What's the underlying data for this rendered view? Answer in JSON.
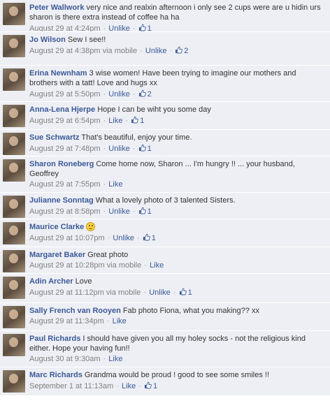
{
  "comments": [
    {
      "author": "Peter Wallwork",
      "text": "very nice and realxin afternoon i only see 2 cups were are u hidin urs sharon is there extra instead of coffee ha ha",
      "time": "August 29 at 4:24pm",
      "via": "",
      "action": "Unlike",
      "likes": "1",
      "smiley": false,
      "height": 46
    },
    {
      "author": "Jo Wilson",
      "text": "Sew I see!!",
      "time": "August 29 at 4:38pm",
      "via": "via mobile",
      "action": "Unlike",
      "likes": "2",
      "smiley": false,
      "height": 48
    },
    {
      "author": "Erina Newnham",
      "text": "3 wise women! Have been trying to imagine our mothers and brothers with a tatt! Love and hugs xx",
      "time": "August 29 at 5:50pm",
      "via": "",
      "action": "Unlike",
      "likes": "2",
      "smiley": false,
      "height": 52
    },
    {
      "author": "Anna-Lena Hjerpe",
      "text": "Hope I can be wiht you some day",
      "time": "August 29 at 6:54pm",
      "via": "",
      "action": "Like",
      "likes": "1",
      "smiley": false,
      "height": 40
    },
    {
      "author": "Sue Schwartz",
      "text": "That's beautiful, enjoy your time.",
      "time": "August 29 at 7:48pm",
      "via": "",
      "action": "Unlike",
      "likes": "1",
      "smiley": false,
      "height": 38
    },
    {
      "author": "Sharon Roneberg",
      "text": "Come home now, Sharon ... I'm hungry !! ... your husband, Geoffrey",
      "time": "August 29 at 7:55pm",
      "via": "",
      "action": "Like",
      "likes": "",
      "smiley": false,
      "height": 52
    },
    {
      "author": "Julianne Sonntag",
      "text": "What a lovely photo of 3 talented Sisters.",
      "time": "August 29 at 8:58pm",
      "via": "",
      "action": "Unlike",
      "likes": "1",
      "smiley": false,
      "height": 38
    },
    {
      "author": "Maurice Clarke",
      "text": "",
      "time": "August 29 at 10:07pm",
      "via": "",
      "action": "Unlike",
      "likes": "1",
      "smiley": true,
      "height": 40
    },
    {
      "author": "Margaret Baker",
      "text": "Great photo",
      "time": "August 29 at 10:28pm",
      "via": "via mobile",
      "action": "Like",
      "likes": "",
      "smiley": false,
      "height": 38
    },
    {
      "author": "Adin Archer",
      "text": "Love",
      "time": "August 29 at 11:12pm",
      "via": "via mobile",
      "action": "Unlike",
      "likes": "1",
      "smiley": false,
      "height": 42
    },
    {
      "author": "Sally French van Rooyen",
      "text": "Fab photo Fiona, what you making?? xx",
      "time": "August 29 at 11:34pm",
      "via": "",
      "action": "Like",
      "likes": "",
      "smiley": false,
      "height": 40
    },
    {
      "author": "Paul Richards",
      "text": "I should have given you all my holey socks - not the religious kind either. Hope your having fun!!",
      "time": "August 30 at 9:30am",
      "via": "",
      "action": "Like",
      "likes": "",
      "smiley": false,
      "height": 52
    },
    {
      "author": "Marc Richards",
      "text": "Grandma would be proud ! good to see some smiles !!",
      "time": "September 1 at 11:13am",
      "via": "",
      "action": "Like",
      "likes": "1",
      "smiley": false,
      "height": 41
    }
  ],
  "colors": {
    "link": "#3b5998",
    "background": "#edeff4",
    "meta": "#808080"
  },
  "icons": {
    "like": "thumbs-up-icon",
    "emoticon": "smiley-icon"
  }
}
